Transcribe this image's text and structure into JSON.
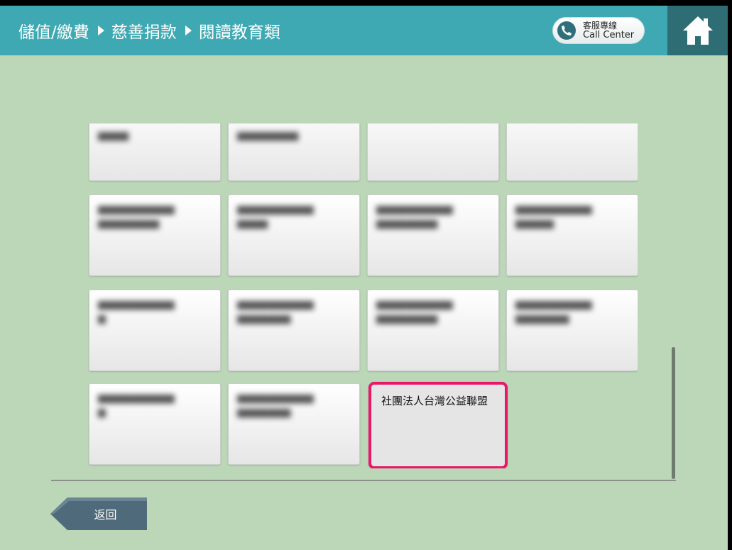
{
  "header": {
    "breadcrumb": [
      "儲值/繳費",
      "慈善捐款",
      "閱讀教育類"
    ],
    "call_center": {
      "line1": "客服專線",
      "line2": "Call Center",
      "icon": "phone-icon"
    },
    "home_icon": "home-icon"
  },
  "grid": {
    "selected_item": {
      "label": "社團法人台灣公益聯盟"
    }
  },
  "footer": {
    "back_label": "返回"
  },
  "colors": {
    "background": "#bcd6b8",
    "header": "#3fa9b3",
    "home_bg": "#2d6d73",
    "selected_border": "#e8176a",
    "back_button": "#4f6a7a"
  }
}
